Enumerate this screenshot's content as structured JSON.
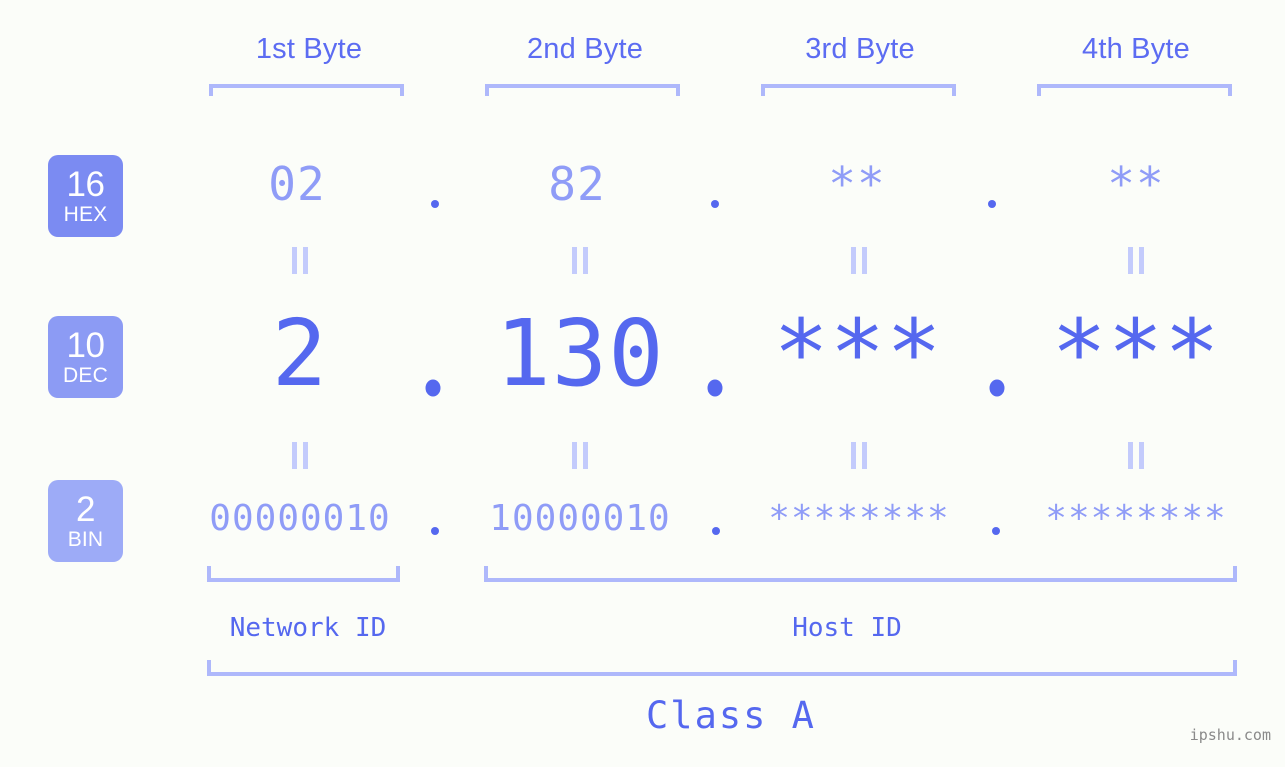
{
  "meta": {
    "background_color": "#fbfdf9",
    "accent_color": "#5568ef",
    "accent_light_color": "#8f9cf7",
    "bracket_color": "#aeb8fb",
    "watermark": "ipshu.com"
  },
  "headers": [
    {
      "label": "1st Byte"
    },
    {
      "label": "2nd Byte"
    },
    {
      "label": "3rd Byte"
    },
    {
      "label": "4th Byte"
    }
  ],
  "rows": [
    {
      "key": "hex",
      "badge_number": "16",
      "badge_name": "HEX",
      "badge_color": "#7b8bf2",
      "values": [
        "02",
        "82",
        "**",
        "**"
      ],
      "separators": [
        ".",
        ".",
        "."
      ]
    },
    {
      "key": "dec",
      "badge_number": "10",
      "badge_name": "DEC",
      "badge_color": "#8c9bf4",
      "values": [
        "2",
        "130",
        "***",
        "***"
      ],
      "separators": [
        ".",
        ".",
        "."
      ]
    },
    {
      "key": "bin",
      "badge_number": "2",
      "badge_name": "BIN",
      "badge_color": "#9dabf7",
      "values": [
        "00000010",
        "10000010",
        "********",
        "********"
      ],
      "separators": [
        ".",
        ".",
        "."
      ]
    }
  ],
  "equals_marks": {
    "symbol": "||",
    "count_per_gap": 4,
    "gaps": 2
  },
  "id_labels": [
    {
      "label": "Network ID"
    },
    {
      "label": "Host ID"
    }
  ],
  "class_label": {
    "label": "Class A"
  },
  "chart_data": {
    "type": "table",
    "title": "IPv4 Address Byte Breakdown",
    "columns": [
      "1st Byte",
      "2nd Byte",
      "3rd Byte",
      "4th Byte"
    ],
    "row_headers": [
      "16 HEX",
      "10 DEC",
      "2 BIN"
    ],
    "rows": [
      [
        "02",
        "82",
        "**",
        "**"
      ],
      [
        "2",
        "130",
        "***",
        "***"
      ],
      [
        "00000010",
        "10000010",
        "********",
        "********"
      ]
    ],
    "annotations": [
      "Network ID",
      "Host ID",
      "Class A"
    ]
  }
}
